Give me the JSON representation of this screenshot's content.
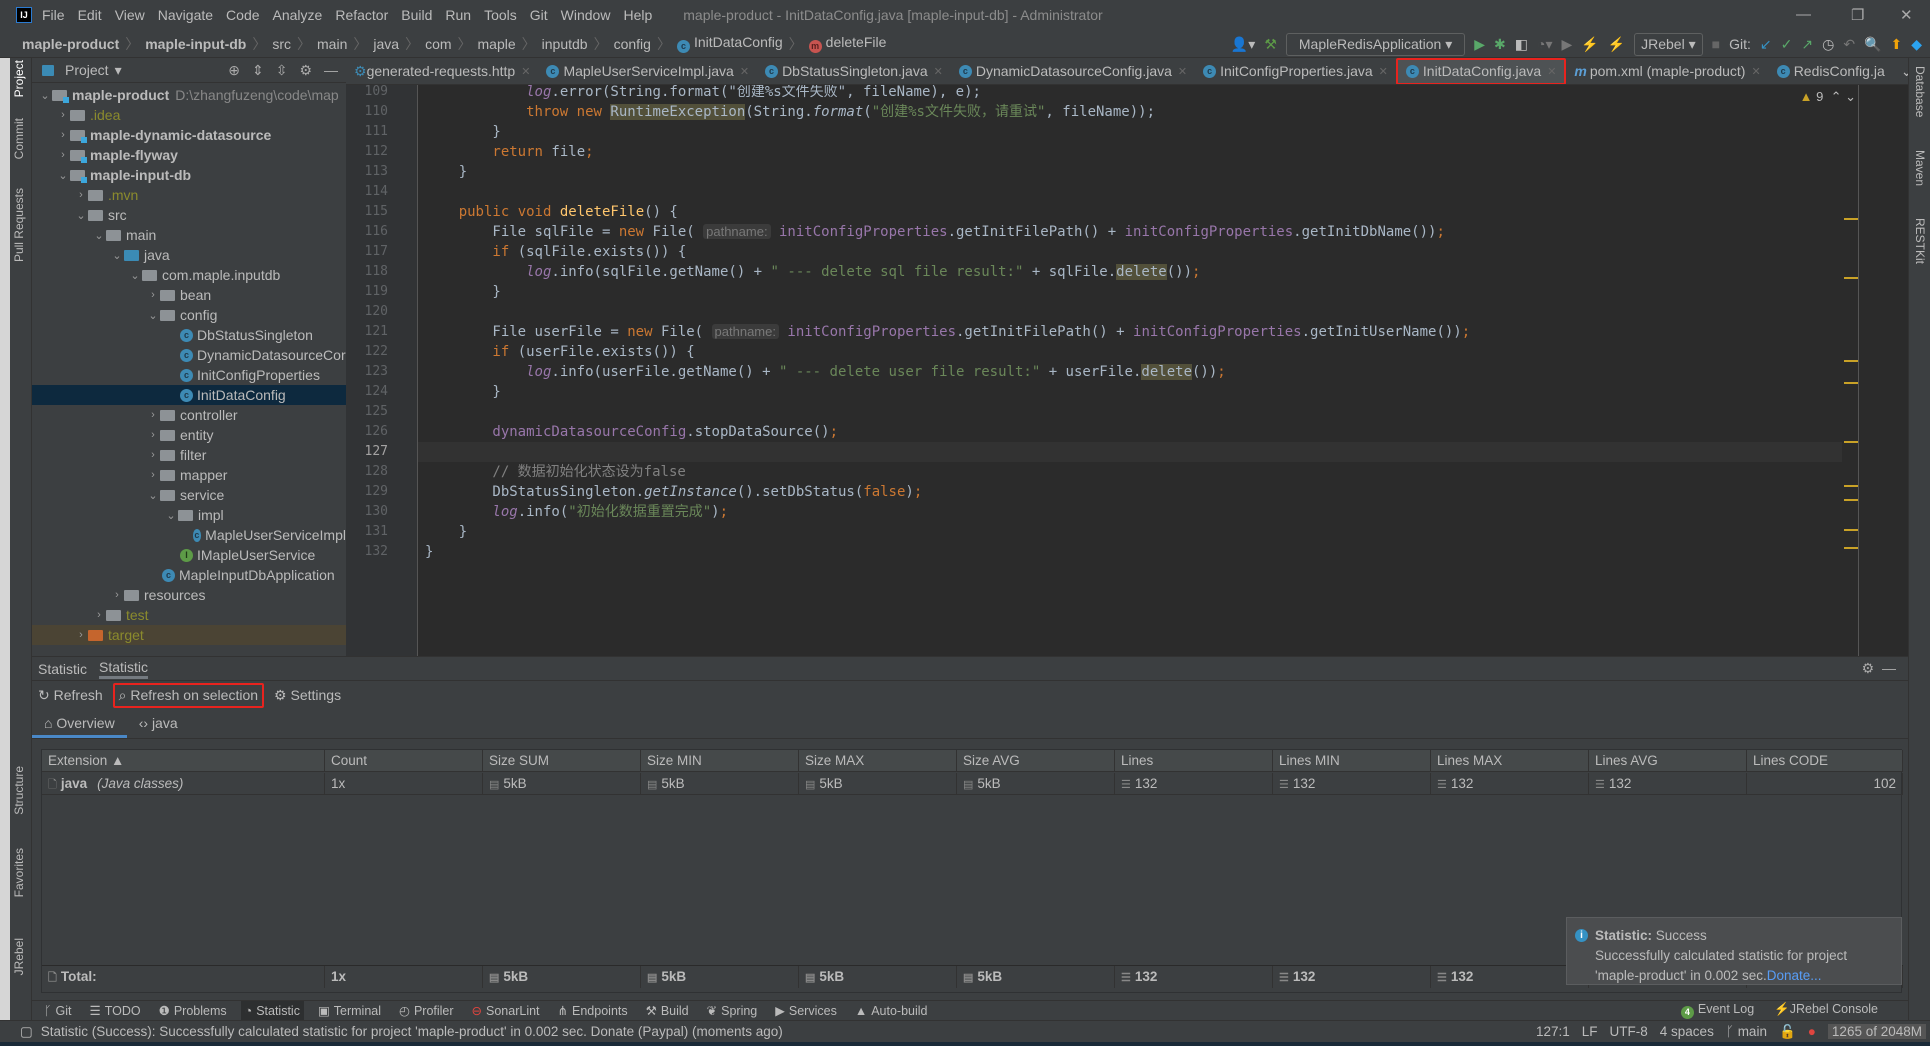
{
  "window": {
    "title": "maple-product - InitDataConfig.java [maple-input-db] - Administrator",
    "logo": "IJ"
  },
  "menu": [
    "File",
    "Edit",
    "View",
    "Navigate",
    "Code",
    "Analyze",
    "Refactor",
    "Build",
    "Run",
    "Tools",
    "Git",
    "Window",
    "Help"
  ],
  "breadcrumb": [
    "maple-product",
    "maple-input-db",
    "src",
    "main",
    "java",
    "com",
    "maple",
    "inputdb",
    "config",
    "InitDataConfig",
    "deleteFile"
  ],
  "toolbar": {
    "run_config": "MapleRedisApplication",
    "jrebel": "JRebel",
    "git_label": "Git:"
  },
  "left_strip": [
    "Project",
    "Commit",
    "Pull Requests",
    "Structure",
    "Favorites",
    "JRebel"
  ],
  "right_strip": [
    "Database",
    "Maven",
    "RESTKit"
  ],
  "project": {
    "title": "Project",
    "tree": [
      {
        "d": 0,
        "a": "v",
        "i": "mod",
        "t": "maple-product",
        "s": "bold",
        "p": "D:\\zhangfuzeng\\code\\map"
      },
      {
        "d": 1,
        "a": ">",
        "i": "folder",
        "t": ".idea",
        "s": "olive"
      },
      {
        "d": 1,
        "a": ">",
        "i": "mod",
        "t": "maple-dynamic-datasource",
        "s": "bold"
      },
      {
        "d": 1,
        "a": ">",
        "i": "mod",
        "t": "maple-flyway",
        "s": "bold"
      },
      {
        "d": 1,
        "a": "v",
        "i": "mod",
        "t": "maple-input-db",
        "s": "bold"
      },
      {
        "d": 2,
        "a": ">",
        "i": "folder",
        "t": ".mvn",
        "s": "olive"
      },
      {
        "d": 2,
        "a": "v",
        "i": "folder",
        "t": "src"
      },
      {
        "d": 3,
        "a": "v",
        "i": "folder",
        "t": "main"
      },
      {
        "d": 4,
        "a": "v",
        "i": "blue",
        "t": "java"
      },
      {
        "d": 5,
        "a": "v",
        "i": "folder",
        "t": "com.maple.inputdb"
      },
      {
        "d": 6,
        "a": ">",
        "i": "folder",
        "t": "bean"
      },
      {
        "d": 6,
        "a": "v",
        "i": "folder",
        "t": "config"
      },
      {
        "d": 7,
        "a": "",
        "i": "class",
        "t": "DbStatusSingleton"
      },
      {
        "d": 7,
        "a": "",
        "i": "class",
        "t": "DynamicDatasourceCor"
      },
      {
        "d": 7,
        "a": "",
        "i": "class",
        "t": "InitConfigProperties"
      },
      {
        "d": 7,
        "a": "",
        "i": "class",
        "t": "InitDataConfig",
        "sel": true
      },
      {
        "d": 6,
        "a": ">",
        "i": "folder",
        "t": "controller"
      },
      {
        "d": 6,
        "a": ">",
        "i": "folder",
        "t": "entity"
      },
      {
        "d": 6,
        "a": ">",
        "i": "folder",
        "t": "filter"
      },
      {
        "d": 6,
        "a": ">",
        "i": "folder",
        "t": "mapper"
      },
      {
        "d": 6,
        "a": "v",
        "i": "folder",
        "t": "service"
      },
      {
        "d": 7,
        "a": "v",
        "i": "folder",
        "t": "impl"
      },
      {
        "d": 8,
        "a": "",
        "i": "class",
        "t": "MapleUserServiceImpl"
      },
      {
        "d": 7,
        "a": "",
        "i": "iface",
        "t": "IMapleUserService"
      },
      {
        "d": 6,
        "a": "",
        "i": "app",
        "t": "MapleInputDbApplication"
      },
      {
        "d": 4,
        "a": ">",
        "i": "folder",
        "t": "resources"
      },
      {
        "d": 3,
        "a": ">",
        "i": "folder",
        "t": "test",
        "s": "olive"
      },
      {
        "d": 2,
        "a": ">",
        "i": "orange",
        "t": "target",
        "s": "olive",
        "excl": true
      }
    ]
  },
  "tabs": [
    {
      "label": "generated-requests.http",
      "icon": "api"
    },
    {
      "label": "MapleUserServiceImpl.java",
      "icon": "class"
    },
    {
      "label": "DbStatusSingleton.java",
      "icon": "class"
    },
    {
      "label": "DynamicDatasourceConfig.java",
      "icon": "class"
    },
    {
      "label": "InitConfigProperties.java",
      "icon": "class"
    },
    {
      "label": "InitDataConfig.java",
      "icon": "class",
      "active": true
    },
    {
      "label": "pom.xml (maple-product)",
      "icon": "maven"
    },
    {
      "label": "RedisConfig.ja",
      "icon": "class"
    }
  ],
  "editor": {
    "warnings": "9",
    "current_line": 127,
    "first_line": 109,
    "lines": [
      [
        [
          3,
          ""
        ],
        [
          "log",
          "fldi"
        ],
        [
          ".error(String.format(\"创建%s文件失败\", fileName), e);",
          ""
        ]
      ],
      [
        [
          3,
          ""
        ],
        [
          "throw new ",
          "kw"
        ],
        [
          "RuntimeException",
          "hl"
        ],
        [
          "(String.",
          ""
        ],
        [
          "format",
          "it"
        ],
        [
          "(",
          ""
        ],
        [
          "\"创建%s文件失败，请重试\"",
          "str"
        ],
        [
          ", fileName));",
          ""
        ]
      ],
      [
        [
          2,
          ""
        ],
        [
          "}",
          ""
        ]
      ],
      [
        [
          2,
          ""
        ],
        [
          "return ",
          "kw"
        ],
        [
          "file",
          ""
        ],
        [
          ";",
          "kw"
        ]
      ],
      [
        [
          1,
          ""
        ],
        [
          "}",
          ""
        ]
      ],
      [
        [
          0,
          ""
        ]
      ],
      [
        [
          1,
          ""
        ],
        [
          "public void ",
          "kw"
        ],
        [
          "deleteFile",
          "fn"
        ],
        [
          "() {",
          ""
        ]
      ],
      [
        [
          2,
          ""
        ],
        [
          "File sqlFile = ",
          ""
        ],
        [
          "new ",
          "kw"
        ],
        [
          "File( ",
          ""
        ],
        [
          "pathname:",
          "hint"
        ],
        [
          " ",
          ""
        ],
        [
          "initConfigProperties",
          "fld"
        ],
        [
          ".getInitFilePath() + ",
          ""
        ],
        [
          "initConfigProperties",
          "fld"
        ],
        [
          ".getInitDbName())",
          ""
        ],
        [
          ";",
          "kw"
        ]
      ],
      [
        [
          2,
          ""
        ],
        [
          "if ",
          "kw"
        ],
        [
          "(sqlFile.exists()) {",
          ""
        ]
      ],
      [
        [
          3,
          ""
        ],
        [
          "log",
          "fldi"
        ],
        [
          ".info(sqlFile.getName() + ",
          ""
        ],
        [
          "\" --- delete sql file result:\"",
          "str"
        ],
        [
          " + sqlFile.",
          ""
        ],
        [
          "delete",
          "hl"
        ],
        [
          "())",
          ""
        ],
        [
          ";",
          "kw"
        ]
      ],
      [
        [
          2,
          ""
        ],
        [
          "}",
          ""
        ]
      ],
      [
        [
          0,
          ""
        ]
      ],
      [
        [
          2,
          ""
        ],
        [
          "File userFile = ",
          ""
        ],
        [
          "new ",
          "kw"
        ],
        [
          "File( ",
          ""
        ],
        [
          "pathname:",
          "hint"
        ],
        [
          " ",
          ""
        ],
        [
          "initConfigProperties",
          "fld"
        ],
        [
          ".getInitFilePath() + ",
          ""
        ],
        [
          "initConfigProperties",
          "fld"
        ],
        [
          ".getInitUserName())",
          ""
        ],
        [
          ";",
          "kw"
        ]
      ],
      [
        [
          2,
          ""
        ],
        [
          "if ",
          "kw"
        ],
        [
          "(userFile.exists()) {",
          ""
        ]
      ],
      [
        [
          3,
          ""
        ],
        [
          "log",
          "fldi"
        ],
        [
          ".info(userFile.getName() + ",
          ""
        ],
        [
          "\" --- delete user file result:\"",
          "str"
        ],
        [
          " + userFile.",
          ""
        ],
        [
          "delete",
          "hl"
        ],
        [
          "())",
          ""
        ],
        [
          ";",
          "kw"
        ]
      ],
      [
        [
          2,
          ""
        ],
        [
          "}",
          ""
        ]
      ],
      [
        [
          0,
          ""
        ]
      ],
      [
        [
          2,
          ""
        ],
        [
          "dynamicDatasourceConfig",
          "fld"
        ],
        [
          ".stopDataSource()",
          ""
        ],
        [
          ";",
          "kw"
        ]
      ],
      [
        [
          0,
          ""
        ]
      ],
      [
        [
          2,
          ""
        ],
        [
          "// 数据初始化状态设为false",
          "cm"
        ]
      ],
      [
        [
          2,
          ""
        ],
        [
          "DbStatusSingleton.",
          ""
        ],
        [
          "getInstance",
          "it"
        ],
        [
          "().setDbStatus(",
          ""
        ],
        [
          "false",
          "kw"
        ],
        [
          ")",
          ""
        ],
        [
          ";",
          "kw"
        ]
      ],
      [
        [
          2,
          ""
        ],
        [
          "log",
          "fldi"
        ],
        [
          ".info(",
          ""
        ],
        [
          "\"初始化数据重置完成\"",
          "str"
        ],
        [
          ")",
          ""
        ],
        [
          ";",
          "kw"
        ]
      ],
      [
        [
          1,
          ""
        ],
        [
          "}",
          ""
        ]
      ],
      [
        [
          0,
          ""
        ],
        [
          "}",
          ""
        ]
      ]
    ]
  },
  "statistic": {
    "panel_tabs": [
      "Statistic",
      "Statistic"
    ],
    "toolbar": {
      "refresh": "Refresh",
      "refresh_on_selection": "Refresh on selection",
      "settings": "Settings"
    },
    "view_tabs": [
      "Overview",
      "java"
    ],
    "columns": [
      "Extension ▲",
      "Count",
      "Size SUM",
      "Size MIN",
      "Size MAX",
      "Size AVG",
      "Lines",
      "Lines MIN",
      "Lines MAX",
      "Lines AVG",
      "Lines CODE"
    ],
    "rows": [
      {
        "ext": "java",
        "desc": "(Java classes)",
        "cells": [
          "1x",
          "5kB",
          "5kB",
          "5kB",
          "5kB",
          "132",
          "132",
          "132",
          "132",
          "102"
        ]
      }
    ],
    "total": {
      "label": "Total:",
      "cells": [
        "1x",
        "5kB",
        "5kB",
        "5kB",
        "5kB",
        "132",
        "132",
        "132",
        "",
        ""
      ]
    }
  },
  "tool_windows": [
    {
      "label": "Git",
      "icon": "git-branch"
    },
    {
      "label": "TODO",
      "icon": "list"
    },
    {
      "label": "Problems",
      "icon": "problems"
    },
    {
      "label": "Statistic",
      "icon": "pie",
      "active": true
    },
    {
      "label": "Terminal",
      "icon": "terminal"
    },
    {
      "label": "Profiler",
      "icon": "profiler"
    },
    {
      "label": "SonarLint",
      "icon": "sonar"
    },
    {
      "label": "Endpoints",
      "icon": "endpoints"
    },
    {
      "label": "Build",
      "icon": "hammer"
    },
    {
      "label": "Spring",
      "icon": "leaf"
    },
    {
      "label": "Services",
      "icon": "services"
    },
    {
      "label": "Auto-build",
      "icon": "auto"
    }
  ],
  "tool_windows_right": {
    "event_log": "Event Log",
    "event_count": "4",
    "jrebel_console": "JRebel Console"
  },
  "status": {
    "message": "Statistic (Success): Successfully calculated statistic for project 'maple-product' in 0.002 sec. Donate (Paypal) (moments ago)",
    "position": "127:1",
    "line_sep": "LF",
    "encoding": "UTF-8",
    "indent": "4 spaces",
    "branch": "main",
    "memory": "1265 of 2048M"
  },
  "notification": {
    "title": "Statistic:",
    "title_status": "Success",
    "body": "Successfully calculated statistic for project 'maple-product' in 0.002 sec.",
    "link": "Donate..."
  },
  "colors": {
    "accent": "#4a88c7",
    "highlight_box": "#e8231e",
    "keyword": "#cc7832",
    "field": "#9876aa",
    "string": "#6a8759"
  }
}
